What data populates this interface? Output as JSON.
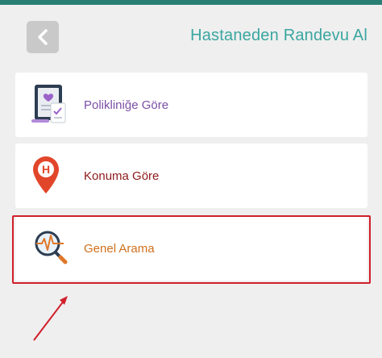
{
  "header": {
    "title": "Hastaneden Randevu Al",
    "back_icon": "chevron-left-icon"
  },
  "options": [
    {
      "label": "Polikliniğe Göre",
      "icon": "clinic-document-icon"
    },
    {
      "label": "Konuma Göre",
      "icon": "hospital-location-pin-icon"
    },
    {
      "label": "Genel Arama",
      "icon": "search-magnifier-pulse-icon"
    }
  ],
  "colors": {
    "topbar": "#2a7f74",
    "title": "#3aa6a0",
    "option_1": "#7b4fa6",
    "option_2": "#8e1a1a",
    "option_3": "#d0701c",
    "highlight": "#d11f2a"
  }
}
